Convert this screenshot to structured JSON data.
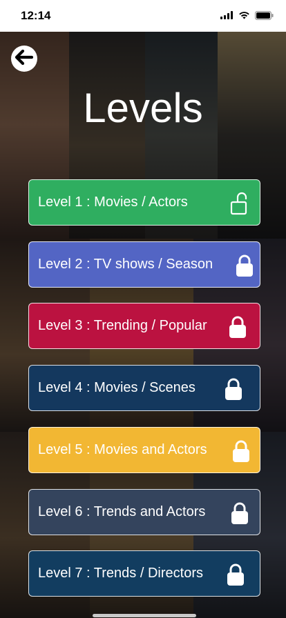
{
  "status_bar": {
    "time": "12:14",
    "icons": [
      "signal-icon",
      "wifi-icon",
      "battery-icon"
    ]
  },
  "header": {
    "back_icon": "arrow-left-icon",
    "title": "Levels"
  },
  "levels": [
    {
      "label": "Level 1 : Movies / Actors",
      "color": "#2fae60",
      "locked": false,
      "icon": "unlocked-padlock-icon"
    },
    {
      "label": "Level 2 : TV shows / Season",
      "color": "#5365c4",
      "locked": true,
      "icon": "padlock-icon"
    },
    {
      "label": "Level 3 : Trending / Popular",
      "color": "#bb1240",
      "locked": true,
      "icon": "padlock-icon"
    },
    {
      "label": "Level 4 : Movies / Scenes",
      "color": "#14385e",
      "locked": true,
      "icon": "padlock-icon"
    },
    {
      "label": "Level 5 : Movies and Actors",
      "color": "#f2b733",
      "locked": true,
      "icon": "padlock-icon"
    },
    {
      "label": "Level 6 : Trends and Actors",
      "color": "#34445d",
      "locked": true,
      "icon": "padlock-icon"
    },
    {
      "label": "Level 7 : Trends / Directors",
      "color": "#123d60",
      "locked": true,
      "icon": "padlock-icon"
    }
  ]
}
